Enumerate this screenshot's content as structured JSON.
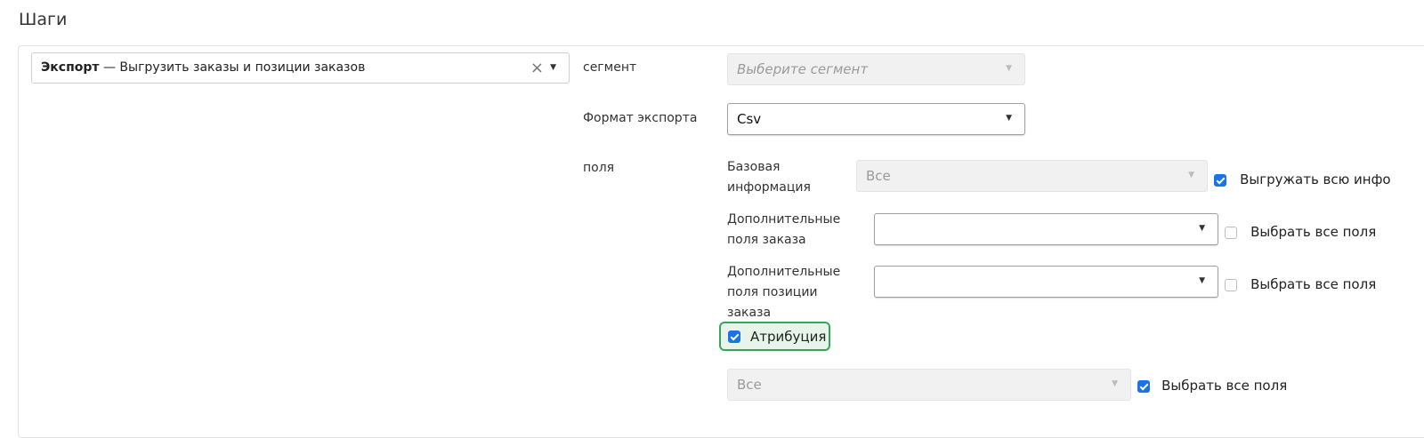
{
  "page": {
    "title": "Шаги"
  },
  "step": {
    "bold": "Экспорт",
    "separator": " — ",
    "text": "Выгрузить заказы и позиции заказов",
    "clear_icon": "×"
  },
  "segment": {
    "label": "сегмент",
    "placeholder": "Выберите сегмент"
  },
  "format": {
    "label": "Формат экспорта",
    "value": "Csv"
  },
  "fields": {
    "label": "поля",
    "basic": {
      "label": "Базовая информация",
      "value": "Все",
      "checkbox_label": "Выгружать всю инфо",
      "checked": true
    },
    "order_extra": {
      "label": "Дополнительные поля заказа",
      "value": "",
      "checkbox_label": "Выбрать все поля",
      "checked": false
    },
    "item_extra": {
      "label": "Дополнительные поля позиции заказа",
      "value": "",
      "checkbox_label": "Выбрать все поля",
      "checked": false
    }
  },
  "attribution": {
    "label": "Атрибуция",
    "checked": true,
    "select_value": "Все",
    "checkbox_label": "Выбрать все поля",
    "select_all_checked": true
  },
  "colors": {
    "checkbox": "#1a73e8",
    "highlight_border": "#3aa35b",
    "highlight_bg": "#e6f4ea"
  }
}
